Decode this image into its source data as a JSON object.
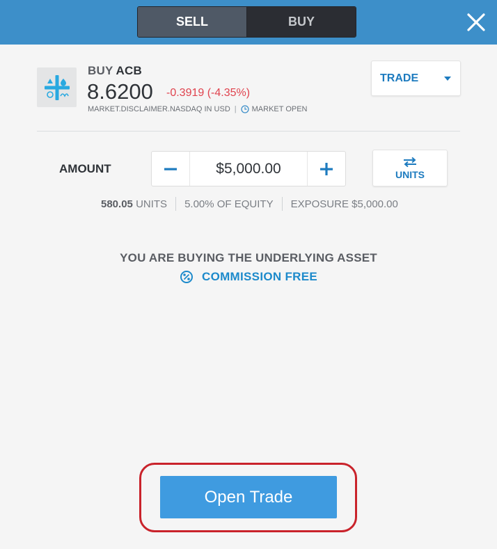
{
  "header": {
    "sell_label": "SELL",
    "buy_label": "BUY",
    "close_icon": "close-icon"
  },
  "instrument": {
    "action": "BUY",
    "symbol": "ACB",
    "price": "8.6200",
    "change": "-0.3919 (-4.35%)",
    "disclaimer": "MARKET.DISCLAIMER.NASDAQ IN USD",
    "separator": "|",
    "market_status": "MARKET OPEN",
    "logo_icon": "instrument-logo-icon"
  },
  "order_type": {
    "label": "TRADE",
    "icon": "caret-down-icon"
  },
  "amount": {
    "label": "AMOUNT",
    "value": "$5,000.00",
    "minus_icon": "minus-icon",
    "plus_icon": "plus-icon"
  },
  "units_toggle": {
    "label": "UNITS",
    "icon": "swap-arrows-icon"
  },
  "stats": {
    "units_value": "580.05",
    "units_label": "UNITS",
    "equity": "5.00% OF EQUITY",
    "exposure_label": "EXPOSURE",
    "exposure_value": "$5,000.00"
  },
  "notice": {
    "text": "YOU ARE BUYING THE UNDERLYING ASSET",
    "commission_label": "COMMISSION FREE",
    "commission_icon": "percent-badge-icon"
  },
  "footer": {
    "open_trade_label": "Open Trade"
  },
  "colors": {
    "header_blue": "#3d8fc9",
    "accent_blue": "#1d7bbf",
    "negative_red": "#e0434e",
    "button_blue": "#3f9be0",
    "highlight_red": "#c9232b"
  }
}
